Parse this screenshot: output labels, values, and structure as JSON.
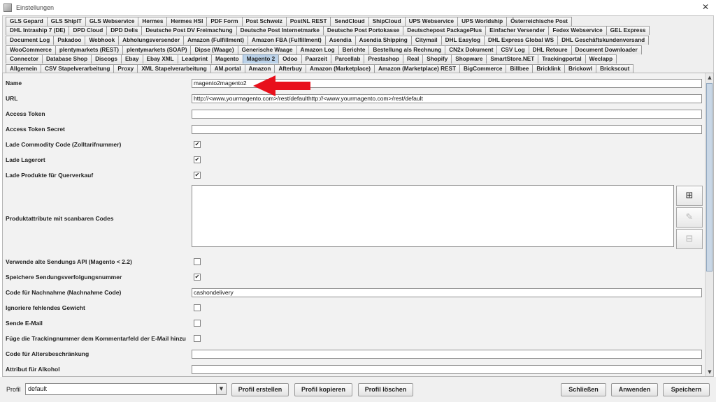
{
  "window": {
    "title": "Einstellungen",
    "close_glyph": "✕"
  },
  "tabs": {
    "row1": [
      "GLS Gepard",
      "GLS ShipIT",
      "GLS Webservice",
      "Hermes",
      "Hermes HSI",
      "PDF Form",
      "Post Schweiz",
      "PostNL REST",
      "SendCloud",
      "ShipCloud",
      "UPS Webservice",
      "UPS Worldship",
      "Österreichische Post"
    ],
    "row2": [
      "DHL Intraship 7 (DE)",
      "DPD Cloud",
      "DPD Delis",
      "Deutsche Post DV Freimachung",
      "Deutsche Post Internetmarke",
      "Deutsche Post Portokasse",
      "Deutschepost PackagePlus",
      "Einfacher Versender",
      "Fedex Webservice",
      "GEL Express"
    ],
    "row3": [
      "Document Log",
      "Pakadoo",
      "Webhook",
      "Abholungsversender",
      "Amazon (Fulfillment)",
      "Amazon FBA (Fulfillment)",
      "Asendia",
      "Asendia Shipping",
      "Citymail",
      "DHL Easylog",
      "DHL Express Global WS",
      "DHL Geschäftskundenversand"
    ],
    "row4": [
      "WooCommerce",
      "plentymarkets (REST)",
      "plentymarkets (SOAP)",
      "Dipse (Waage)",
      "Generische Waage",
      "Amazon Log",
      "Berichte",
      "Bestellung als Rechnung",
      "CN2x Dokument",
      "CSV Log",
      "DHL Retoure",
      "Document Downloader"
    ],
    "row5": [
      "Connector",
      "Database Shop",
      "Discogs",
      "Ebay",
      "Ebay XML",
      "Leadprint",
      "Magento",
      "Magento 2",
      "Odoo",
      "Paarzeit",
      "Parcellab",
      "Prestashop",
      "Real",
      "Shopify",
      "Shopware",
      "SmartStore.NET",
      "Trackingportal",
      "Weclapp"
    ],
    "row6": [
      "Allgemein",
      "CSV Stapelverarbeitung",
      "Proxy",
      "XML Stapelverarbeitung",
      "AM.portal",
      "Amazon",
      "Afterbuy",
      "Amazon (Marketplace)",
      "Amazon (Marketplace) REST",
      "BigCommerce",
      "Billbee",
      "Bricklink",
      "Brickowl",
      "Brickscout"
    ],
    "active": "Magento 2"
  },
  "form": {
    "name": {
      "label": "Name",
      "value": "magento2magento2"
    },
    "url": {
      "label": "URL",
      "value": "http://<www.yourmagento.com>/rest/defaulthttp://<www.yourmagento.com>/rest/default"
    },
    "access_token": {
      "label": "Access Token",
      "value": ""
    },
    "access_token_secret": {
      "label": "Access Token Secret",
      "value": ""
    },
    "lade_commodity": {
      "label": "Lade Commodity Code (Zolltarifnummer)",
      "checked": true
    },
    "lade_lagerort": {
      "label": "Lade Lagerort",
      "checked": true
    },
    "lade_produkte": {
      "label": "Lade Produkte für Querverkauf",
      "checked": true
    },
    "produktattribute": {
      "label": "Produktattribute mit scanbaren Codes"
    },
    "alte_api": {
      "label": "Verwende alte Sendungs API (Magento < 2.2)",
      "checked": false
    },
    "speichere_sendung": {
      "label": "Speichere Sendungsverfolgungsnummer",
      "checked": true
    },
    "nachnahme_code": {
      "label": "Code für Nachnahme (Nachnahme Code)",
      "value": "cashondelivery"
    },
    "ignoriere_gewicht": {
      "label": "Ignoriere fehlendes Gewicht",
      "checked": false
    },
    "sende_email": {
      "label": "Sende E-Mail",
      "checked": false
    },
    "trackingnummer_kommentar": {
      "label": "Füge die Trackingnummer dem Kommentarfeld der E-Mail hinzu",
      "checked": false
    },
    "altersbeschraenkung": {
      "label": "Code für Altersbeschränkung",
      "value": ""
    },
    "alkohol": {
      "label": "Attribut für Alkohol",
      "value": ""
    }
  },
  "side_buttons": {
    "add": "⊞",
    "edit": "✎",
    "remove": "⊟"
  },
  "checkmark": "✔",
  "bottom": {
    "profil_label": "Profil",
    "profil_value": "default",
    "profil_erstellen": "Profil erstellen",
    "profil_kopieren": "Profil kopieren",
    "profil_loeschen": "Profil löschen",
    "schliessen": "Schließen",
    "anwenden": "Anwenden",
    "speichern": "Speichern"
  },
  "colors": {
    "active_tab": "#bcd3ea",
    "arrow": "#e8101c"
  }
}
